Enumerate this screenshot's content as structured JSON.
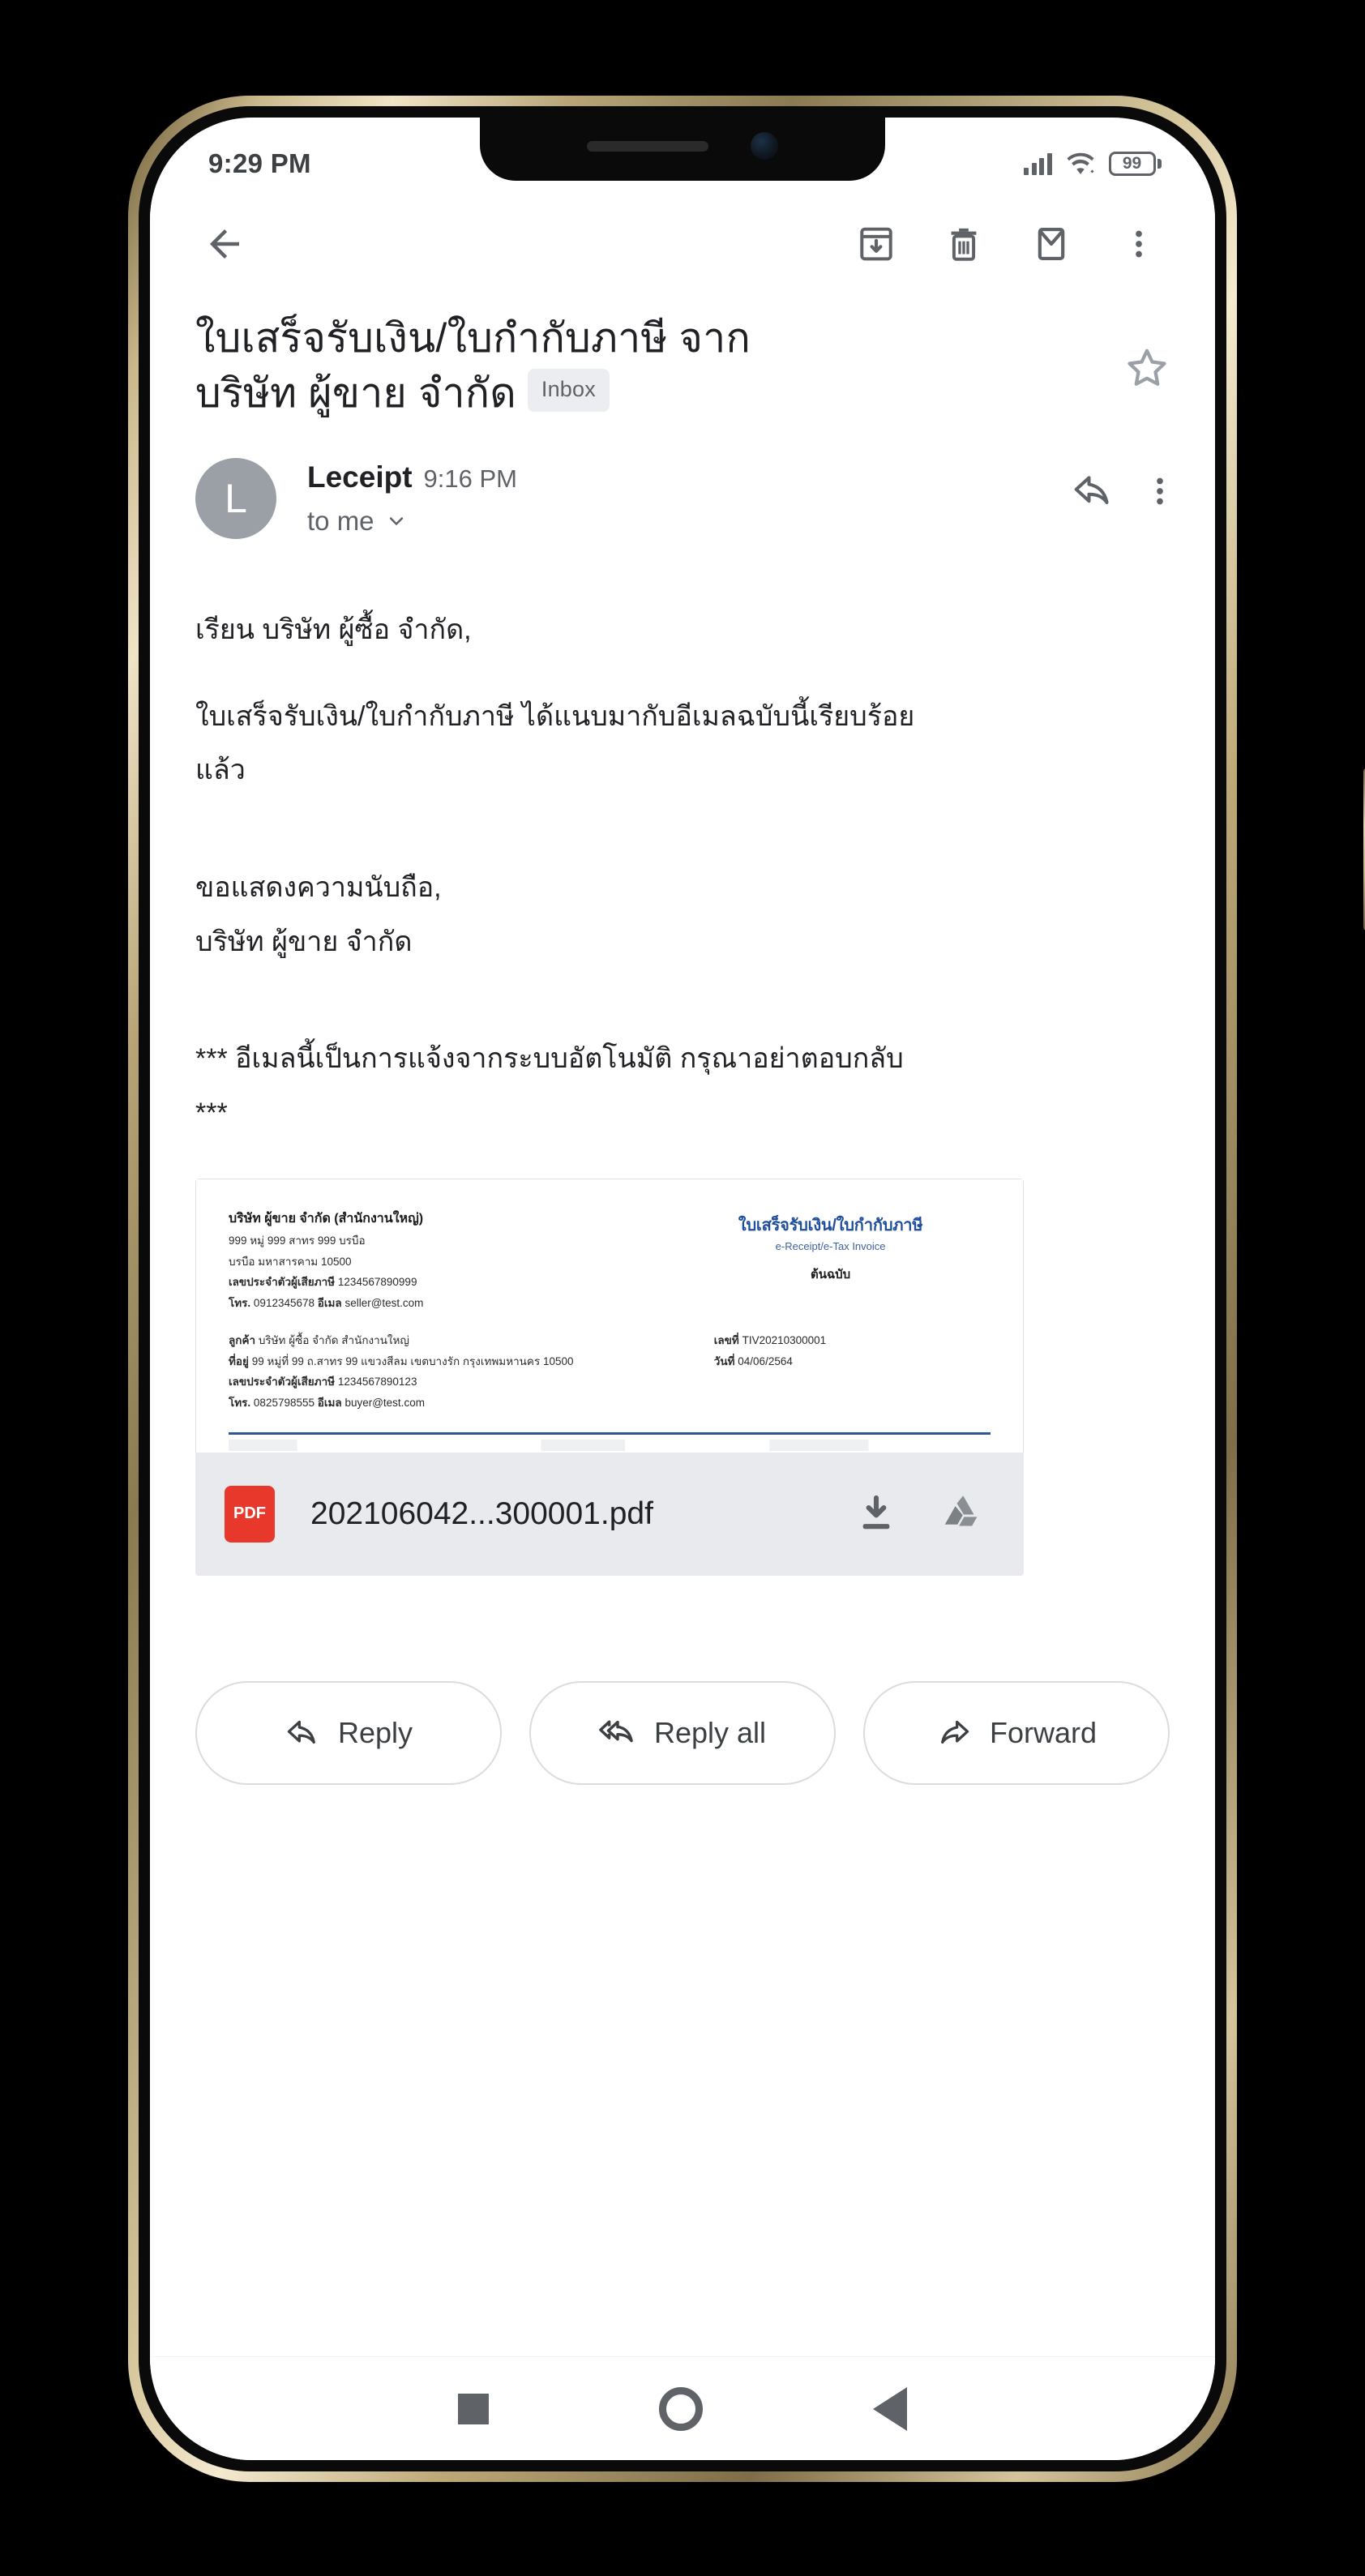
{
  "status_bar": {
    "time": "9:29 PM",
    "battery_level": "99",
    "signal_icon": "signal-bars-icon",
    "wifi_icon": "wifi-icon",
    "battery_icon": "battery-icon"
  },
  "toolbar": {
    "back_icon": "back-arrow-icon",
    "archive_icon": "archive-icon",
    "delete_icon": "trash-icon",
    "mark_unread_icon": "envelope-icon",
    "overflow_icon": "more-vert-icon"
  },
  "email": {
    "subject_line1": "ใบเสร็จรับเงิน/ใบกำกับภาษี จาก",
    "subject_line2": "บริษัท ผู้ขาย จำกัด",
    "label_chip": "Inbox",
    "star_icon": "star-outline-icon",
    "sender_initial": "L",
    "sender_name": "Leceipt",
    "sender_time": "9:16 PM",
    "recipient": "to me",
    "recipient_expand_icon": "chevron-down-icon",
    "reply_icon": "reply-arrow-icon",
    "overflow_icon": "more-vert-icon",
    "body": [
      "เรียน บริษัท ผู้ซื้อ จำกัด,",
      "ใบเสร็จรับเงิน/ใบกำกับภาษี ได้แนบมากับอีเมลฉบับนี้เรียบร้อย",
      "แล้ว",
      "ขอแสดงความนับถือ,",
      "บริษัท ผู้ขาย จำกัด",
      "*** อีเมลนี้เป็นการแจ้งจากระบบอัตโนมัติ กรุณาอย่าตอบกลับ",
      "***"
    ]
  },
  "attachment": {
    "file_name": "202106042...300001.pdf",
    "file_type_badge": "PDF",
    "download_icon": "download-icon",
    "save_to_drive_icon": "google-drive-icon",
    "preview": {
      "doc_title_th": "ใบเสร็จรับเงิน/ใบกำกับภาษี",
      "doc_title_en": "e-Receipt/e-Tax Invoice",
      "doc_copy_type": "ต้นฉบับ",
      "seller_name": "บริษัท ผู้ขาย จำกัด (สำนักงานใหญ่)",
      "seller_address1": "999 หมู่ 999 สาทร 999 บรบือ",
      "seller_address2": "บรบือ มหาสารคาม 10500",
      "seller_tax_label": "เลขประจำตัวผู้เสียภาษี",
      "seller_tax_id": "1234567890999",
      "seller_phone_label": "โทร.",
      "seller_phone": "0912345678",
      "seller_email_label": "อีเมล",
      "seller_email": "seller@test.com",
      "buyer_label": "ลูกค้า",
      "buyer_name": "บริษัท ผู้ซื้อ จำกัด สำนักงานใหญ่",
      "buyer_address_label": "ที่อยู่",
      "buyer_address": "99 หมู่ที่ 99 ถ.สาทร 99 แขวงสีลม เขตบางรัก กรุงเทพมหานคร 10500",
      "buyer_tax_label": "เลขประจำตัวผู้เสียภาษี",
      "buyer_tax_id": "1234567890123",
      "buyer_phone_label": "โทร.",
      "buyer_phone": "0825798555",
      "buyer_email_label": "อีเมล",
      "buyer_email": "buyer@test.com",
      "doc_number_label": "เลขที่",
      "doc_number": "TIV20210300001",
      "doc_date_label": "วันที่",
      "doc_date": "04/06/2564"
    }
  },
  "actions": {
    "reply": "Reply",
    "reply_all": "Reply all",
    "forward": "Forward",
    "reply_icon": "reply-arrow-icon",
    "reply_all_icon": "reply-all-arrow-icon",
    "forward_icon": "forward-arrow-icon"
  },
  "navbar": {
    "recents_icon": "square-recents-icon",
    "home_icon": "circle-home-icon",
    "back_icon": "triangle-back-icon"
  },
  "colors": {
    "pdf_red": "#e8382c",
    "doc_blue": "#1f4e9c",
    "chip_bg": "#ebedf0",
    "attachment_bar_bg": "#e8eaed",
    "icon_gray": "#5f6368"
  }
}
